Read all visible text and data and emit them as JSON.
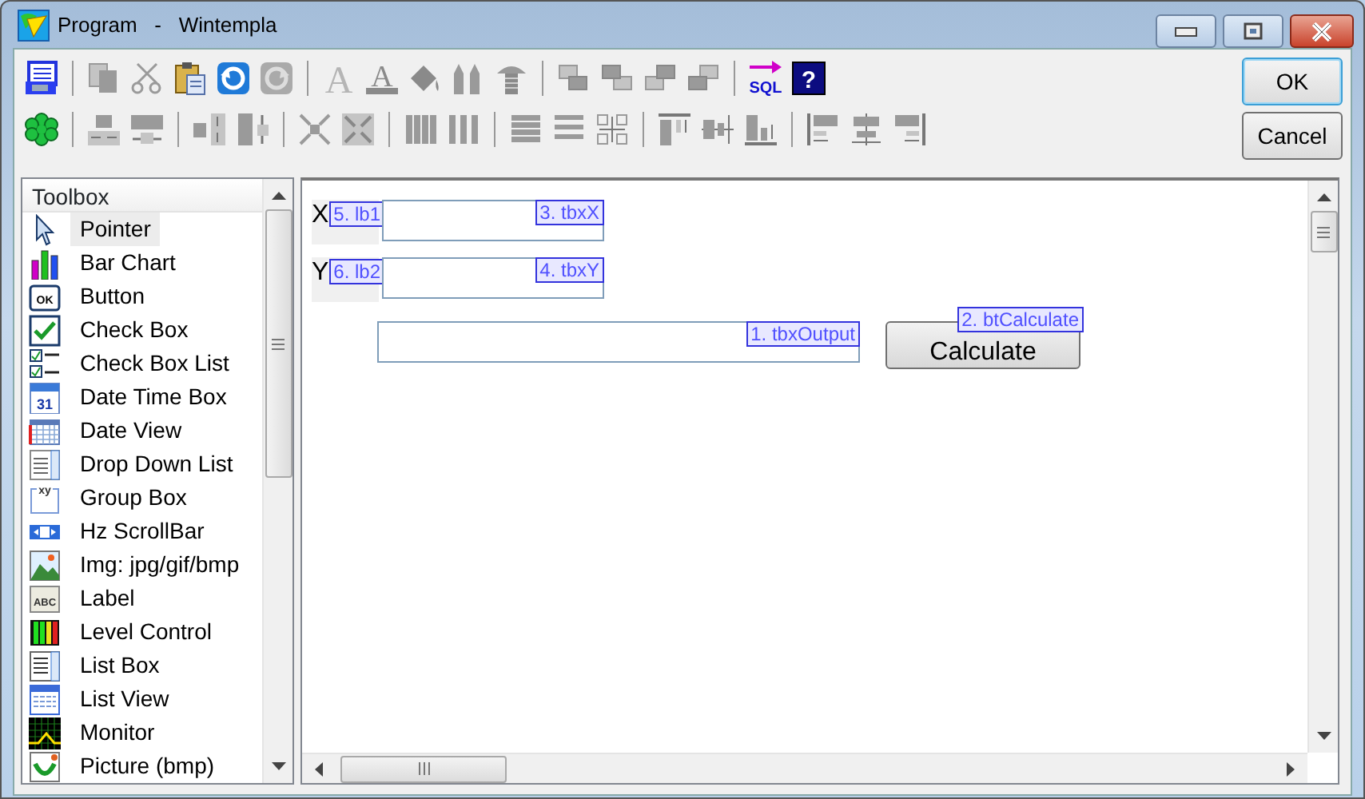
{
  "window": {
    "title": "Program   -   Wintempla"
  },
  "toolbar": {
    "font_label": "A",
    "font_style_label": "A",
    "sql_label": "SQL",
    "help_label": "?"
  },
  "dialog_buttons": [
    {
      "label": "OK",
      "default": true
    },
    {
      "label": "Cancel",
      "default": false
    }
  ],
  "toolbox": {
    "title": "Toolbox",
    "items": [
      {
        "label": "Pointer",
        "selected": true
      },
      {
        "label": "Bar Chart",
        "selected": false
      },
      {
        "label": "Button",
        "selected": false,
        "icon_text": "OK"
      },
      {
        "label": "Check Box",
        "selected": false
      },
      {
        "label": "Check Box List",
        "selected": false
      },
      {
        "label": "Date Time Box",
        "selected": false,
        "icon_text": "31"
      },
      {
        "label": "Date View",
        "selected": false
      },
      {
        "label": "Drop Down List",
        "selected": false
      },
      {
        "label": "Group Box",
        "selected": false,
        "icon_text": "xy"
      },
      {
        "label": "Hz ScrollBar",
        "selected": false
      },
      {
        "label": "Img: jpg/gif/bmp",
        "selected": false
      },
      {
        "label": "Label",
        "selected": false,
        "icon_text": "ABC"
      },
      {
        "label": "Level Control",
        "selected": false
      },
      {
        "label": "List Box",
        "selected": false
      },
      {
        "label": "List View",
        "selected": false
      },
      {
        "label": "Monitor",
        "selected": false
      },
      {
        "label": "Picture (bmp)",
        "selected": false
      }
    ]
  },
  "designer": {
    "rows": [
      {
        "controls": [
          {
            "kind": "label",
            "text": "X",
            "tag": "5. lb1"
          },
          {
            "kind": "textbox",
            "tag": "3. tbxX"
          }
        ]
      },
      {
        "controls": [
          {
            "kind": "label",
            "text": "Y",
            "tag": "6. lb2"
          },
          {
            "kind": "textbox",
            "tag": "4. tbxY"
          }
        ]
      },
      {
        "controls": [
          {
            "kind": "textbox",
            "wide": true,
            "tag": "1. tbxOutput"
          },
          {
            "kind": "button",
            "text": "Calculate",
            "tag": "2. btCalculate"
          }
        ]
      }
    ]
  }
}
